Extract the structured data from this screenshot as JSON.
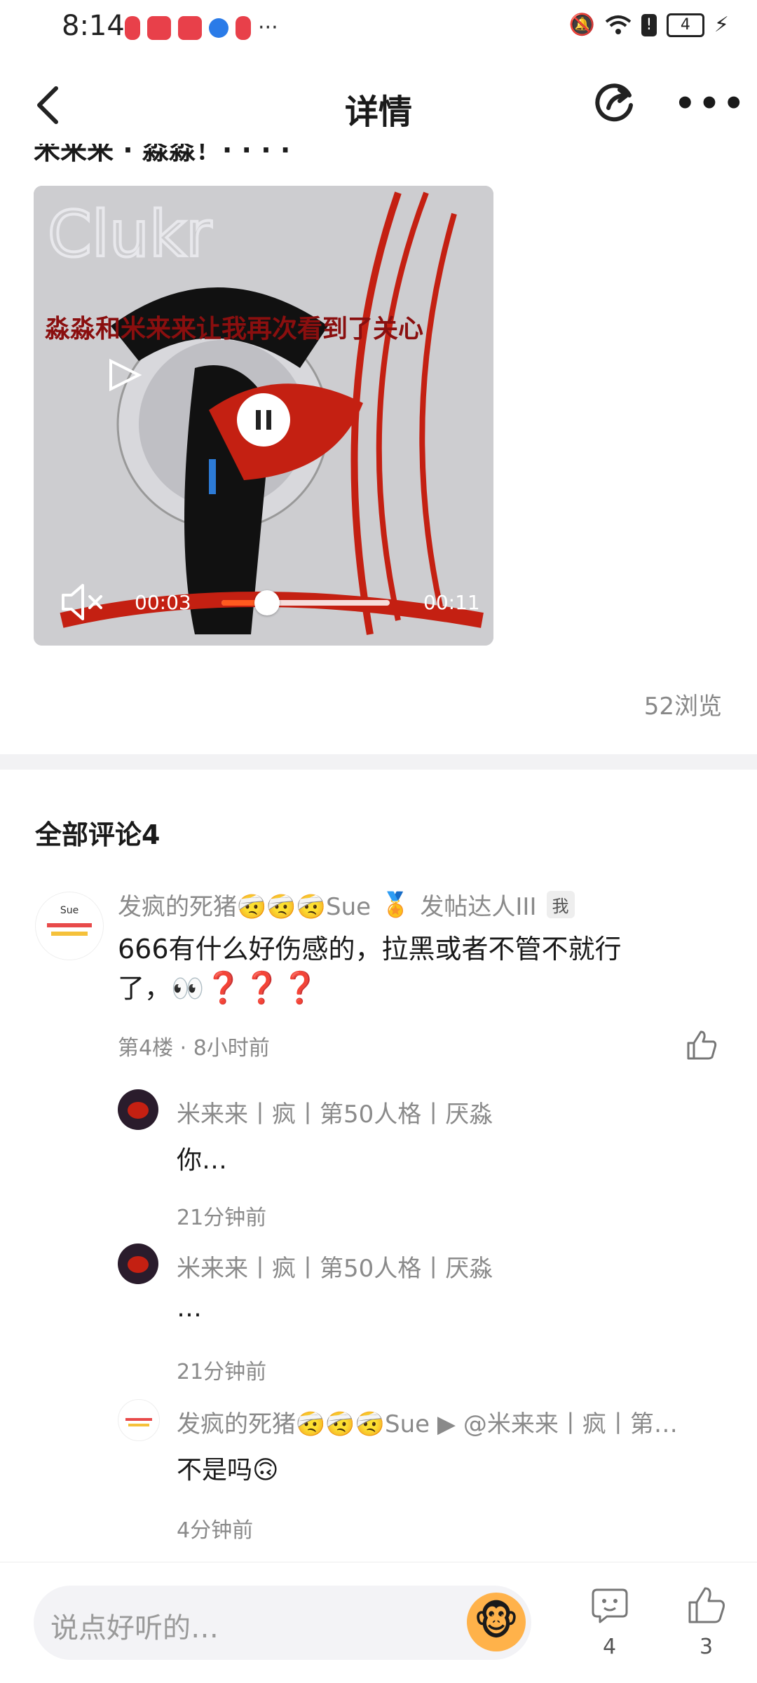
{
  "status_bar": {
    "time": "8:14",
    "battery": "4"
  },
  "header": {
    "title": "详情"
  },
  "post": {
    "truncated_text": "米来来 · 淼淼！· · · ·",
    "video": {
      "caption": "淼淼和米来来让我再次看到了关心",
      "current_time": "00:03",
      "total_time": "00:11",
      "progress": 0.27,
      "muted": true
    },
    "views": "52浏览"
  },
  "comments_section": {
    "title": "全部评论4",
    "main_comment": {
      "username": "发疯的死猪🤕🤕🤕Sue",
      "title_badge": "发帖达人III",
      "me_badge": "我",
      "text_line1": "666有什么好伤感的，拉黑或者不管不就行",
      "text_line2": "了，👀",
      "floor_time": "第4楼 · 8小时前"
    },
    "replies": [
      {
        "username": "米来来丨疯丨第50人格丨厌淼",
        "text": "你…",
        "time": "21分钟前"
      },
      {
        "username": "米来来丨疯丨第50人格丨厌淼",
        "text": "…",
        "time": "21分钟前"
      },
      {
        "username": "发疯的死猪🤕🤕🤕Sue ▶ @米来来丨疯丨第…",
        "text": "不是吗🙃",
        "time": "4分钟前"
      }
    ]
  },
  "bottom_bar": {
    "placeholder": "说点好听的…",
    "comment_count": "4",
    "like_count": "3"
  }
}
